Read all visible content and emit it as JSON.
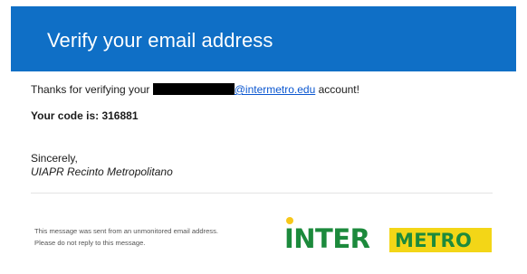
{
  "header": {
    "title": "Verify your email address",
    "background": "#0f6fc6"
  },
  "message": {
    "intro_prefix": "Thanks for verifying your ",
    "email_domain": "@intermetro.edu",
    "intro_suffix": " account!",
    "code_line": "Your code is: 316881",
    "closing": "Sincerely,",
    "signature": "UIAPR Recinto Metropolitano"
  },
  "footer": {
    "note_line1": "This message was sent from an unmonitored email address.",
    "note_line2": "Please do not reply to this message."
  },
  "logo": {
    "part1": "INTER",
    "part2": "METRO",
    "green": "#1c8a3c",
    "yellow": "#f3d617"
  }
}
